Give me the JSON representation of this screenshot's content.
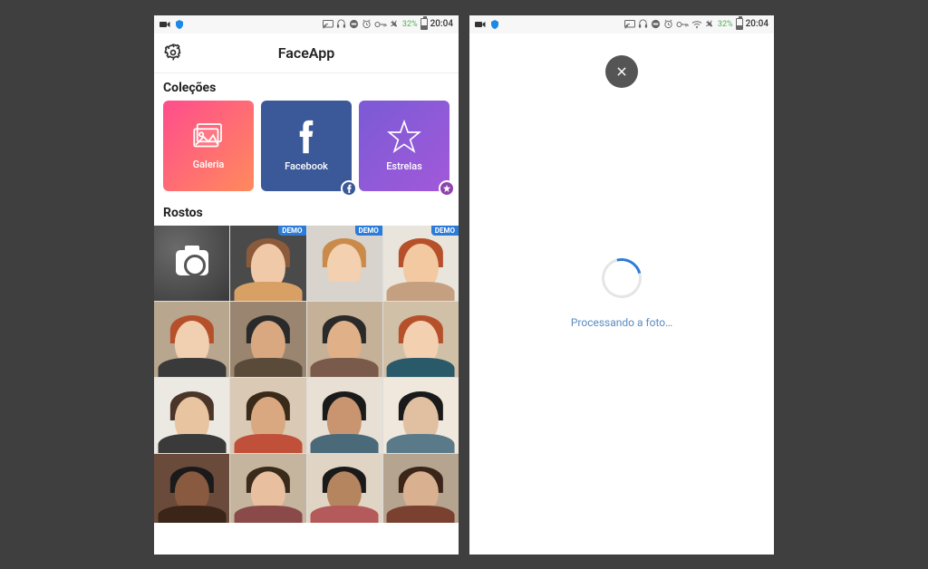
{
  "status_bar": {
    "battery_percent": "32%",
    "time": "20:04"
  },
  "screen1": {
    "app_title": "FaceApp",
    "section_collections": "Coleções",
    "section_faces": "Rostos",
    "collections": {
      "galeria": "Galeria",
      "facebook": "Facebook",
      "estrelas": "Estrelas"
    },
    "demo_label": "DEMO"
  },
  "screen2": {
    "processing_text": "Processando a foto…"
  },
  "faces": {
    "row1": [
      {
        "bg": "#4a4a4a",
        "skin": "#f0c9a8",
        "hair": "#8a5a3a",
        "body": "#d9a066",
        "demo": true
      },
      {
        "bg": "#d8d3cc",
        "skin": "#f2d0b0",
        "hair": "#c98a4a",
        "body": "#d8d3cc",
        "demo": true
      },
      {
        "bg": "#e9e5dd",
        "skin": "#f2c9a0",
        "hair": "#b5502a",
        "body": "#c5a080",
        "demo": true
      }
    ],
    "row2": [
      {
        "bg": "#b8a68f",
        "skin": "#f0d0b0",
        "hair": "#b5502a",
        "body": "#3a3a3a"
      },
      {
        "bg": "#9a8570",
        "skin": "#d9a880",
        "hair": "#2a2a2a",
        "body": "#5a4a3a"
      },
      {
        "bg": "#c5b098",
        "skin": "#e0b088",
        "hair": "#2a2a2a",
        "body": "#7a5a4a"
      },
      {
        "bg": "#d0c0a8",
        "skin": "#f2d0b0",
        "hair": "#b5502a",
        "body": "#2a5a6a"
      }
    ],
    "row3": [
      {
        "bg": "#ece8e2",
        "skin": "#e8c4a0",
        "hair": "#4a3528",
        "body": "#3a3a3a"
      },
      {
        "bg": "#d9c9b5",
        "skin": "#d9a880",
        "hair": "#3a2a1a",
        "body": "#c0503a"
      },
      {
        "bg": "#e8e0d5",
        "skin": "#c99570",
        "hair": "#1a1a1a",
        "body": "#4a6a7a"
      },
      {
        "bg": "#f0e8dc",
        "skin": "#e0c0a0",
        "hair": "#1a1a1a",
        "body": "#5a7a8a"
      }
    ],
    "row4": [
      {
        "bg": "#6a4a3a",
        "skin": "#8a5a40",
        "hair": "#1a1a1a",
        "body": "#3a2518"
      },
      {
        "bg": "#c5b59f",
        "skin": "#e8c0a0",
        "hair": "#3a2a1a",
        "body": "#8a4a4a"
      },
      {
        "bg": "#e0d5c5",
        "skin": "#b58560",
        "hair": "#1a1a1a",
        "body": "#b55a5a"
      },
      {
        "bg": "#b5a590",
        "skin": "#d9b090",
        "hair": "#3a2518",
        "body": "#7a4030"
      }
    ]
  }
}
